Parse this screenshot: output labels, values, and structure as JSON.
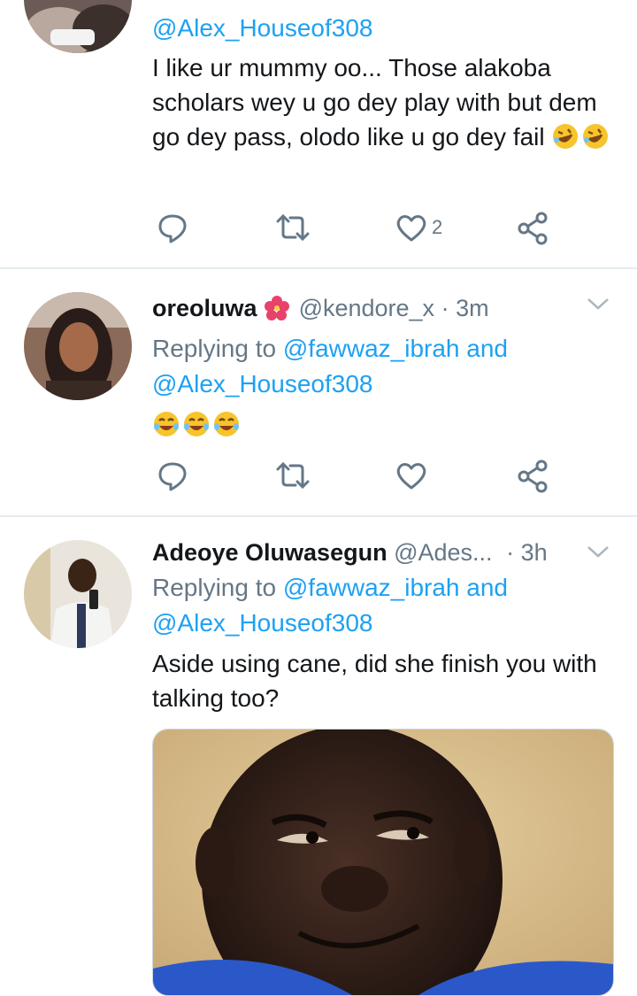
{
  "tweet1": {
    "handle_top": "@Alex_Houseof308",
    "text": "I like ur mummy oo... Those alakoba scholars wey u go dey play with but dem go dey pass, olodo like u go dey fail",
    "like_count": "2"
  },
  "tweet2": {
    "name": "oreoluwa",
    "handle": "@kendore_x",
    "separator": "·",
    "time": "3m",
    "replying_prefix": "Replying to",
    "replying_user": "@fawwaz_ibrah",
    "replying_and": "and",
    "replying_user2": "@Alex_Houseof308"
  },
  "tweet3": {
    "name": "Adeoye Oluwasegun",
    "handle": "@Ades...",
    "separator": "·",
    "time": "3h",
    "replying_prefix": "Replying to",
    "replying_user": "@fawwaz_ibrah",
    "replying_and": "and",
    "replying_user2": "@Alex_Houseof308",
    "text": "Aside using cane, did she finish you with talking too?"
  },
  "colors": {
    "link": "#1da1f2",
    "secondary": "#657786",
    "divider": "#e6ecf0"
  },
  "icons": [
    "reply-icon",
    "retweet-icon",
    "like-icon",
    "share-icon",
    "chevron-down-icon"
  ]
}
